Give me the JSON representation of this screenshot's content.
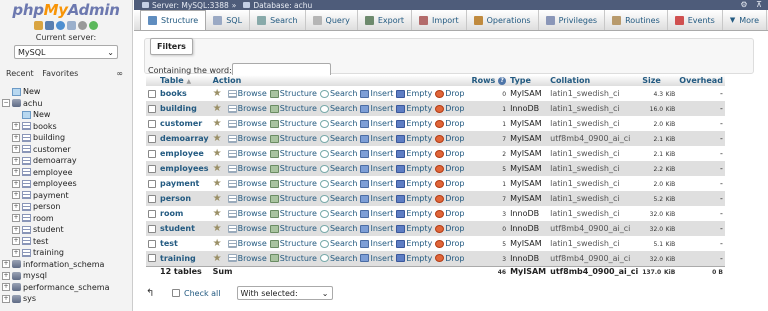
{
  "logo": {
    "php": "php",
    "my": "My",
    "admin": "Admin"
  },
  "left": {
    "current_server_label": "Current server:",
    "server_value": "MySQL",
    "recent": "Recent",
    "favorites": "Favorites",
    "link_icon_text": "∞",
    "tree": [
      {
        "label": "New",
        "level": 0,
        "icon": "new-icon",
        "conn": ""
      },
      {
        "label": "achu",
        "level": 0,
        "icon": "database-icon",
        "conn": "−"
      },
      {
        "label": "New",
        "level": 1,
        "icon": "new-icon",
        "conn": ""
      },
      {
        "label": "books",
        "level": 1,
        "icon": "table-icon",
        "conn": "+"
      },
      {
        "label": "building",
        "level": 1,
        "icon": "table-icon",
        "conn": "+"
      },
      {
        "label": "customer",
        "level": 1,
        "icon": "table-icon",
        "conn": "+"
      },
      {
        "label": "demoarray",
        "level": 1,
        "icon": "table-icon",
        "conn": "+"
      },
      {
        "label": "employee",
        "level": 1,
        "icon": "table-icon",
        "conn": "+"
      },
      {
        "label": "employees",
        "level": 1,
        "icon": "table-icon",
        "conn": "+"
      },
      {
        "label": "payment",
        "level": 1,
        "icon": "table-icon",
        "conn": "+"
      },
      {
        "label": "person",
        "level": 1,
        "icon": "table-icon",
        "conn": "+"
      },
      {
        "label": "room",
        "level": 1,
        "icon": "table-icon",
        "conn": "+"
      },
      {
        "label": "student",
        "level": 1,
        "icon": "table-icon",
        "conn": "+"
      },
      {
        "label": "test",
        "level": 1,
        "icon": "table-icon",
        "conn": "+"
      },
      {
        "label": "training",
        "level": 1,
        "icon": "table-icon",
        "conn": "+"
      },
      {
        "label": "information_schema",
        "level": 0,
        "icon": "database-icon",
        "conn": "+"
      },
      {
        "label": "mysql",
        "level": 0,
        "icon": "database-icon",
        "conn": "+"
      },
      {
        "label": "performance_schema",
        "level": 0,
        "icon": "database-icon",
        "conn": "+"
      },
      {
        "label": "sys",
        "level": 0,
        "icon": "database-icon",
        "conn": "+"
      }
    ]
  },
  "topbar": {
    "server": "Server: MySQL:3388",
    "sep": "»",
    "database": "Database: achu",
    "gear": "⚙",
    "collapse": "⊼"
  },
  "tabs": [
    {
      "label": "Structure",
      "color": "#5f8dbf"
    },
    {
      "label": "SQL",
      "color": "#9aa9c4"
    },
    {
      "label": "Search",
      "color": "#8aa"
    },
    {
      "label": "Query",
      "color": "#b5b5b5"
    },
    {
      "label": "Export",
      "color": "#6d8a6d"
    },
    {
      "label": "Import",
      "color": "#b36b6b"
    },
    {
      "label": "Operations",
      "color": "#c08a3e"
    },
    {
      "label": "Privileges",
      "color": "#8a96b8"
    },
    {
      "label": "Routines",
      "color": "#b89a6c"
    },
    {
      "label": "Events",
      "color": "#d05050"
    },
    {
      "label": "More",
      "color": ""
    }
  ],
  "filters": {
    "legend": "Filters",
    "label": "Containing the word:",
    "value": ""
  },
  "table_headers": {
    "table": "Table",
    "action": "Action",
    "rows": "Rows",
    "type": "Type",
    "collation": "Collation",
    "size": "Size",
    "overhead": "Overhead"
  },
  "actions": {
    "browse": "Browse",
    "structure": "Structure",
    "search": "Search",
    "insert": "Insert",
    "empty": "Empty",
    "drop": "Drop"
  },
  "rows": [
    {
      "name": "books",
      "rows": "0",
      "type": "MyISAM",
      "collation": "latin1_swedish_ci",
      "size": "4.3",
      "unit": "KiB",
      "overhead": "-"
    },
    {
      "name": "building",
      "rows": "1",
      "type": "InnoDB",
      "collation": "latin1_swedish_ci",
      "size": "16.0",
      "unit": "KiB",
      "overhead": "-"
    },
    {
      "name": "customer",
      "rows": "1",
      "type": "MyISAM",
      "collation": "latin1_swedish_ci",
      "size": "2.0",
      "unit": "KiB",
      "overhead": "-"
    },
    {
      "name": "demoarray",
      "rows": "7",
      "type": "MyISAM",
      "collation": "utf8mb4_0900_ai_ci",
      "size": "2.1",
      "unit": "KiB",
      "overhead": "-"
    },
    {
      "name": "employee",
      "rows": "2",
      "type": "MyISAM",
      "collation": "latin1_swedish_ci",
      "size": "2.1",
      "unit": "KiB",
      "overhead": "-"
    },
    {
      "name": "employees",
      "rows": "5",
      "type": "MyISAM",
      "collation": "latin1_swedish_ci",
      "size": "2.2",
      "unit": "KiB",
      "overhead": "-"
    },
    {
      "name": "payment",
      "rows": "1",
      "type": "MyISAM",
      "collation": "latin1_swedish_ci",
      "size": "2.0",
      "unit": "KiB",
      "overhead": "-"
    },
    {
      "name": "person",
      "rows": "7",
      "type": "MyISAM",
      "collation": "latin1_swedish_ci",
      "size": "5.2",
      "unit": "KiB",
      "overhead": "-"
    },
    {
      "name": "room",
      "rows": "3",
      "type": "InnoDB",
      "collation": "latin1_swedish_ci",
      "size": "32.0",
      "unit": "KiB",
      "overhead": "-"
    },
    {
      "name": "student",
      "rows": "0",
      "type": "InnoDB",
      "collation": "utf8mb4_0900_ai_ci",
      "size": "32.0",
      "unit": "KiB",
      "overhead": "-"
    },
    {
      "name": "test",
      "rows": "5",
      "type": "MyISAM",
      "collation": "latin1_swedish_ci",
      "size": "5.1",
      "unit": "KiB",
      "overhead": "-"
    },
    {
      "name": "training",
      "rows": "3",
      "type": "InnoDB",
      "collation": "utf8mb4_0900_ai_ci",
      "size": "32.0",
      "unit": "KiB",
      "overhead": "-"
    }
  ],
  "footer": {
    "count": "12 tables",
    "sum": "Sum",
    "rows": "46",
    "type": "MyISAM",
    "collation": "utf8mb4_0900_ai_ci",
    "size": "137.0",
    "unit": "KiB",
    "overhead": "0 B"
  },
  "bottom": {
    "check_all": "Check all",
    "with_selected": "With selected:",
    "arrow": "↰"
  },
  "colors": {
    "accent": "#235a81",
    "topbar": "#4e5c7a",
    "row_alt": "#dfdfdf"
  }
}
